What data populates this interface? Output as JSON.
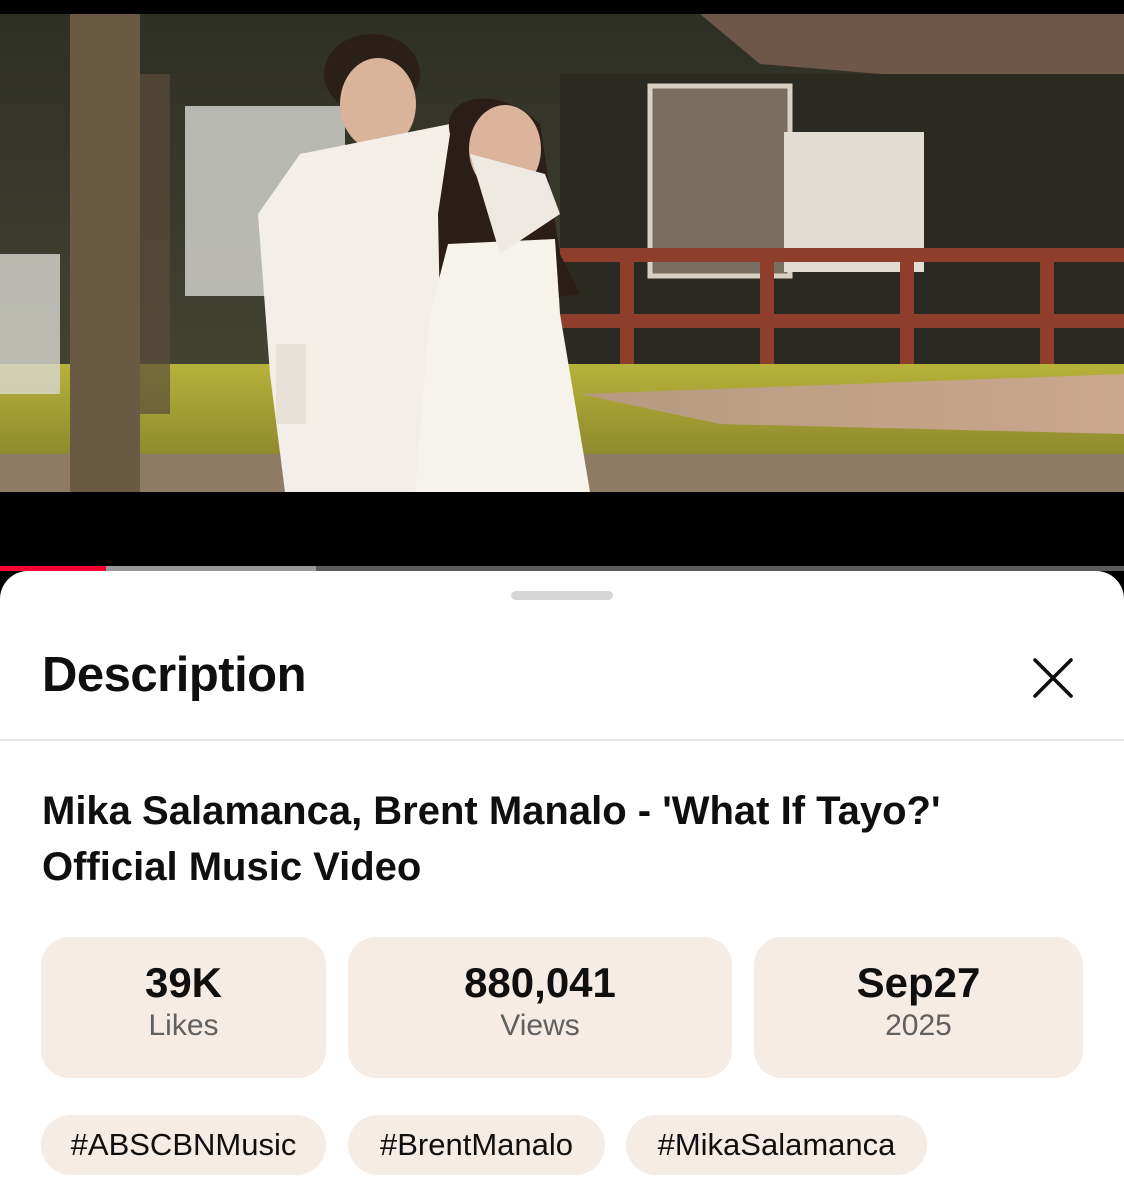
{
  "player": {
    "progress_played": 0.094,
    "progress_buffered": 0.281
  },
  "sheet": {
    "title": "Description",
    "close_icon": "close-icon"
  },
  "video": {
    "title": "Mika Salamanca, Brent Manalo - 'What If Tayo?' Official Music Video"
  },
  "stats": [
    {
      "value": "39K",
      "label": "Likes"
    },
    {
      "value": "880,041",
      "label": "Views"
    },
    {
      "value": "Sep27",
      "label": "2025"
    }
  ],
  "hashtags": [
    "#ABSCBNMusic",
    "#BrentManalo",
    "#MikaSalamanca"
  ],
  "colors": {
    "accent": "#ff0033",
    "chip_background": "#f6ece6"
  }
}
